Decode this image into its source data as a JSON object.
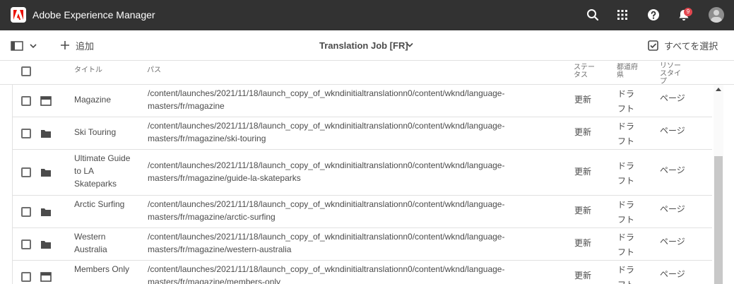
{
  "header": {
    "app_title": "Adobe Experience Manager",
    "notification_count": "9",
    "icons": [
      "search-icon",
      "apps-grid-icon",
      "help-icon",
      "bell-icon",
      "avatar"
    ]
  },
  "actionbar": {
    "add_label": "追加",
    "job_title": "Translation Job [FR]",
    "select_all_label": "すべてを選択"
  },
  "columns": {
    "title": "タイトル",
    "path": "パス",
    "status_line1": "ステー",
    "status_line2": "タス",
    "workflow_line1": "都道府",
    "workflow_line2": "県",
    "type_line1": "リソー",
    "type_line2": "スタイ",
    "type_line3": "プ"
  },
  "rows": [
    {
      "icon": "page-icon",
      "title": "Magazine",
      "path_line1": "/content/launches/2021/11/18/launch_copy_of_wkndinitialtranslationn0/content/wknd/language-",
      "path_line2": "masters/fr/magazine",
      "status": "更新",
      "workflow_line1": "ドラ",
      "workflow_line2": "フト",
      "type": "ページ"
    },
    {
      "icon": "folder-icon",
      "title": "Ski Touring",
      "path_line1": "/content/launches/2021/11/18/launch_copy_of_wkndinitialtranslationn0/content/wknd/language-",
      "path_line2": "masters/fr/magazine/ski-touring",
      "status": "更新",
      "workflow_line1": "ドラ",
      "workflow_line2": "フト",
      "type": "ページ"
    },
    {
      "icon": "folder-icon",
      "title": "Ultimate Guide to LA Skateparks",
      "path_line1": "/content/launches/2021/11/18/launch_copy_of_wkndinitialtranslationn0/content/wknd/language-",
      "path_line2": "masters/fr/magazine/guide-la-skateparks",
      "status": "更新",
      "workflow_line1": "ドラ",
      "workflow_line2": "フト",
      "type": "ページ"
    },
    {
      "icon": "folder-icon",
      "title": "Arctic Surfing",
      "path_line1": "/content/launches/2021/11/18/launch_copy_of_wkndinitialtranslationn0/content/wknd/language-",
      "path_line2": "masters/fr/magazine/arctic-surfing",
      "status": "更新",
      "workflow_line1": "ドラ",
      "workflow_line2": "フト",
      "type": "ページ"
    },
    {
      "icon": "folder-icon",
      "title": "Western Australia",
      "path_line1": "/content/launches/2021/11/18/launch_copy_of_wkndinitialtranslationn0/content/wknd/language-",
      "path_line2": "masters/fr/magazine/western-australia",
      "status": "更新",
      "workflow_line1": "ドラ",
      "workflow_line2": "フト",
      "type": "ページ"
    },
    {
      "icon": "page-icon",
      "title": "Members Only",
      "path_line1": "/content/launches/2021/11/18/launch_copy_of_wkndinitialtranslationn0/content/wknd/language-",
      "path_line2": "masters/fr/magazine/members-only",
      "status": "更新",
      "workflow_line1": "ドラ",
      "workflow_line2": "フト",
      "type": "ページ"
    }
  ],
  "colors": {
    "header_bg": "#323232",
    "brand_red": "#eb1000",
    "badge_red": "#e34850",
    "text": "#4b4b4b"
  }
}
